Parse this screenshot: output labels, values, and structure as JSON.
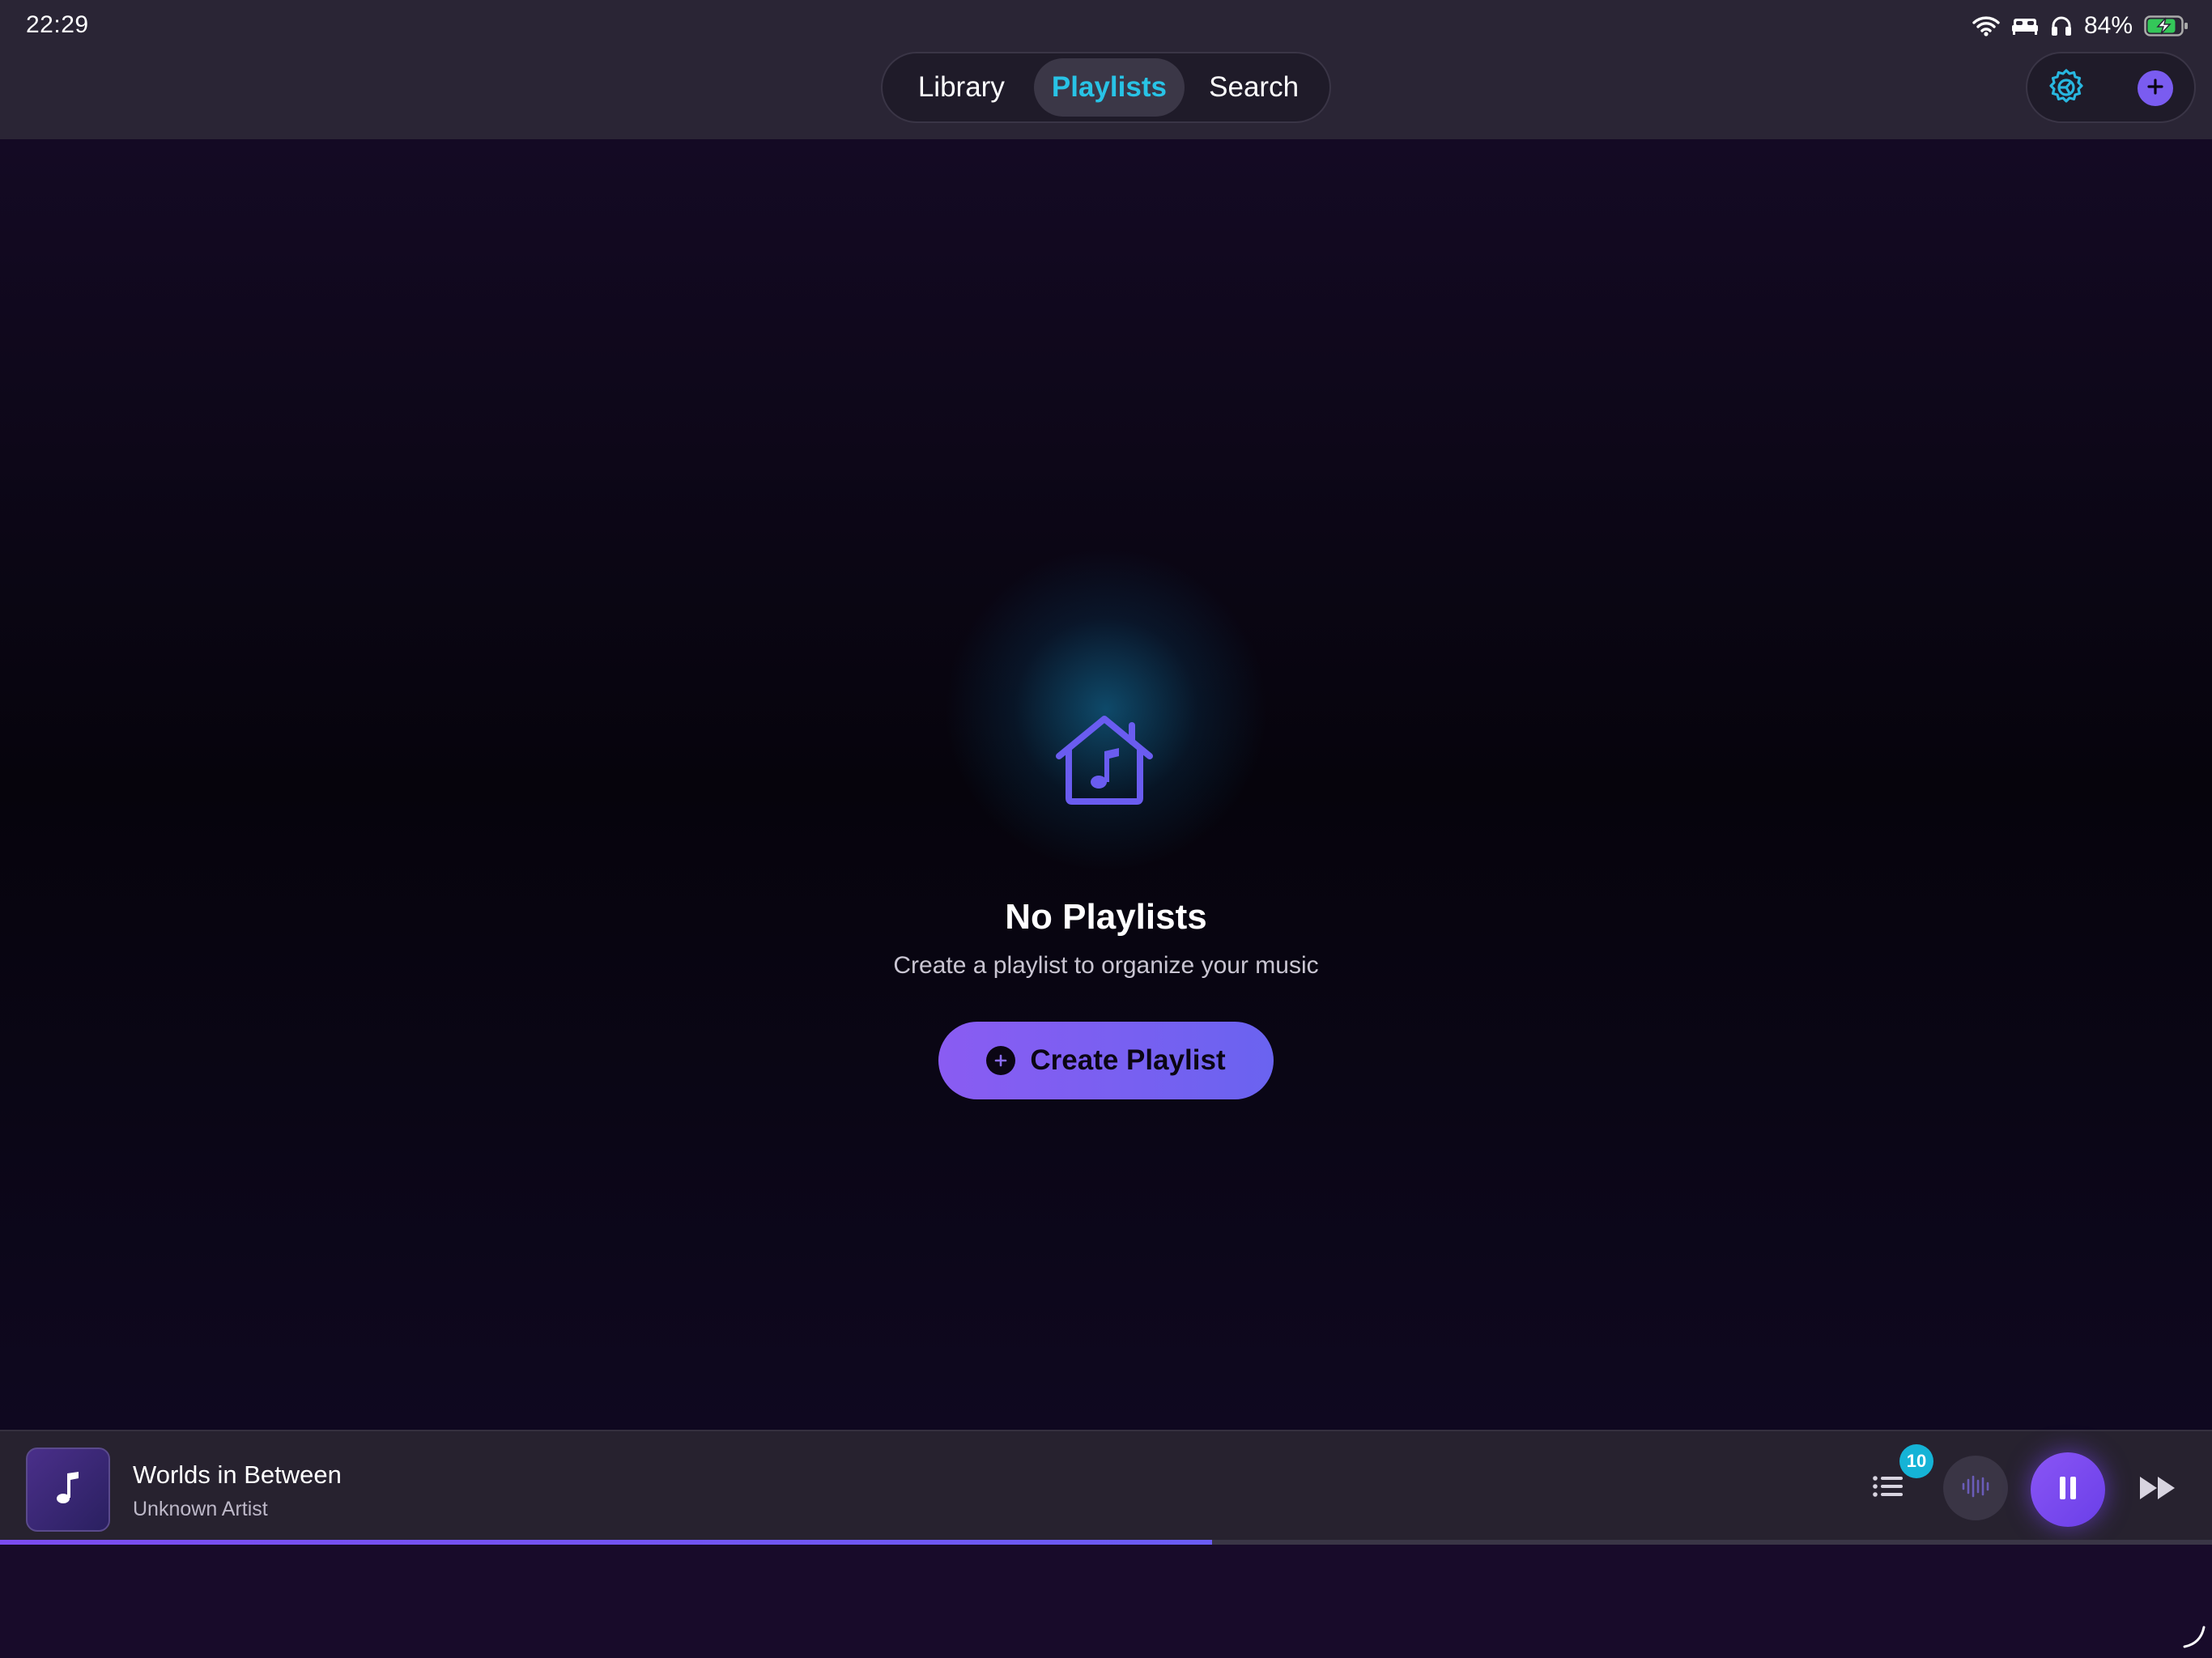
{
  "status_bar": {
    "time": "22:29",
    "battery_percent": "84%",
    "icons": [
      "wifi-icon",
      "bed-icon",
      "headphones-icon",
      "battery-charging-icon"
    ]
  },
  "nav": {
    "tabs": [
      {
        "label": "Library",
        "selected": false
      },
      {
        "label": "Playlists",
        "selected": true
      },
      {
        "label": "Search",
        "selected": false
      }
    ],
    "actions": [
      "gear-icon",
      "plus-icon"
    ]
  },
  "empty_state": {
    "icon": "music-house-icon",
    "title": "No Playlists",
    "subtitle": "Create a playlist to organize your music",
    "button_label": "Create Playlist"
  },
  "now_playing": {
    "title": "Worlds in Between",
    "artist": "Unknown Artist",
    "queue_count": "10",
    "progress": 0.548,
    "is_playing": true
  },
  "colors": {
    "accent": "#7a5cf0",
    "selected_tab_text": "#28c3e6",
    "badge": "#15b3d6",
    "background": "#0b0614"
  }
}
